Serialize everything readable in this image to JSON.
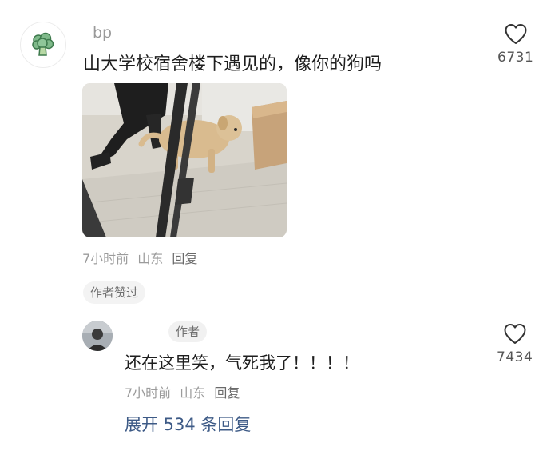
{
  "comment": {
    "username": "bp",
    "text": "山大学校宿舍楼下遇见的，像你的狗吗",
    "like_count": "6731",
    "meta": {
      "time": "7小时前",
      "location": "山东",
      "reply_label": "回复"
    },
    "author_liked_badge": "作者赞过",
    "avatar_icon": "broccoli-icon",
    "image_subject": "dog"
  },
  "reply": {
    "author_tag": "作者",
    "text": "还在这里笑，气死我了！！！！",
    "like_count": "7434",
    "meta": {
      "time": "7小时前",
      "location": "山东",
      "reply_label": "回复"
    }
  },
  "expand_replies": {
    "label": "展开 534 条回复"
  },
  "colors": {
    "link": "#3d5a86",
    "muted": "#9b9b9b",
    "icon_stroke": "#333333"
  }
}
